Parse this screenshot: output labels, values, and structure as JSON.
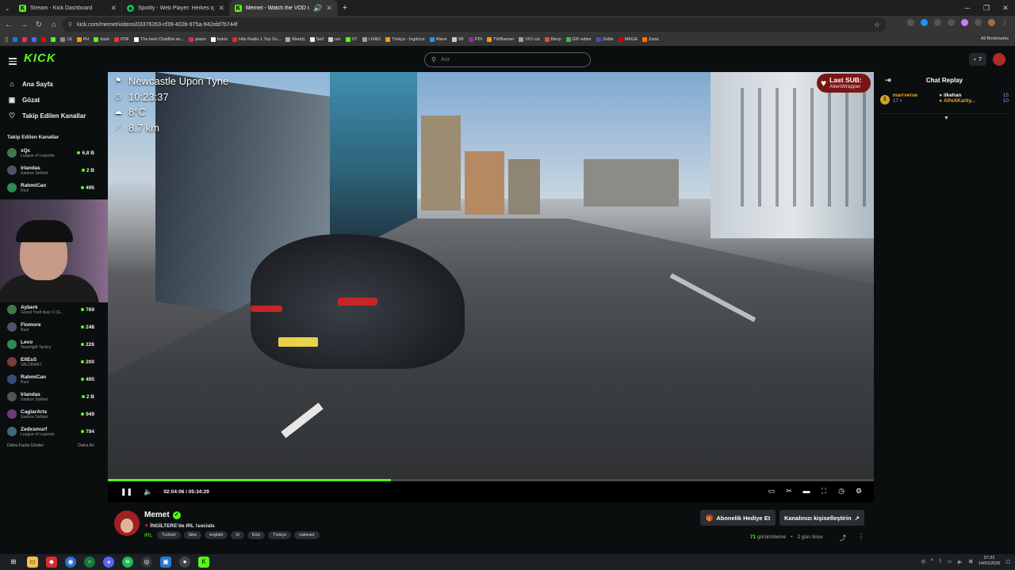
{
  "browser": {
    "tabs": [
      {
        "title": "Stream - Kick Dashboard",
        "color": "#53fc18",
        "glyph": "K"
      },
      {
        "title": "Spotify - Web Player: Herkes için",
        "color": "#1db954",
        "glyph": "●"
      },
      {
        "title": "Memet - Watch the VOD on",
        "color": "#53fc18",
        "glyph": "K"
      }
    ],
    "url": "kick.com/memet/videos/03376263-cf39-402b-975a-942ebf7b744f",
    "bookmarks": [
      "L8",
      "PH",
      "dash",
      "PDF",
      "The best ChatBot an...",
      "piano",
      "botrix",
      "Hits Radio 1 Top So...",
      "Metafy",
      "Sell",
      "rev",
      "XT",
      "LIVAD",
      "Türkçe - İngilizce",
      "Wave",
      "SB",
      "PDI",
      "TWBanner",
      "VIO cut",
      "Blerp",
      "GIF editor",
      "Zettle",
      "MEGA",
      "Zaria"
    ],
    "all_bookmarks": "All Bookmarks"
  },
  "header": {
    "logo": "KICK",
    "search_placeholder": "Ara",
    "viewer_count": "7"
  },
  "sidebar": {
    "nav": [
      {
        "label": "Ana Sayfa",
        "icon": "home-icon",
        "glyph": "⌂"
      },
      {
        "label": "Gözat",
        "icon": "browse-icon",
        "glyph": "▣"
      },
      {
        "label": "Takip Edilen Kanallar",
        "icon": "heart-icon",
        "glyph": "♡"
      }
    ],
    "section_title": "Takip Edilen Kanallar",
    "channels_top": [
      {
        "name": "xQc",
        "category": "League of Legends",
        "viewers": "6,8 B"
      },
      {
        "name": "Irlandas",
        "category": "Sadece Sohbet",
        "viewers": "2 B"
      },
      {
        "name": "RahmiCan",
        "category": "Rust",
        "viewers": "495"
      }
    ],
    "channels_bottom": [
      {
        "name": "Ayberk",
        "category": "Grand Theft Auto V (G...",
        "viewers": "769"
      },
      {
        "name": "Flomore",
        "category": "Rust",
        "viewers": "248"
      },
      {
        "name": "Levo",
        "category": "Teamfight Tactics",
        "viewers": "226"
      },
      {
        "name": "EllEsS",
        "category": "VALORANT",
        "viewers": "200"
      },
      {
        "name": "RahmiCan",
        "category": "Rust",
        "viewers": "495"
      },
      {
        "name": "Irlandas",
        "category": "Sadece Sohbet",
        "viewers": "2 B"
      },
      {
        "name": "CaglarArts",
        "category": "Sadece Sohbet",
        "viewers": "949"
      },
      {
        "name": "Zedxsmurf",
        "category": "League of Legends",
        "viewers": "794"
      }
    ],
    "show_more": "Daha Fazla Göster",
    "show_less": "Daha Az"
  },
  "player": {
    "hud": {
      "location": "Newcastle Upon Tyne",
      "time": "10:23:37",
      "temp": "8°C",
      "distance": "8.7 km"
    },
    "last_sub_title": "Last SUB:",
    "last_sub_user": "AlienWrapper",
    "time_current": "02:04:06",
    "time_total": "05:34:29",
    "progress": 0.37,
    "accent": "#53fc18"
  },
  "chat": {
    "title": "Chat Replay",
    "gifters": [
      {
        "rank": "1",
        "name": "marrverse",
        "count": "17"
      },
      {
        "name": "ilkehan",
        "count": "15"
      },
      {
        "name": "APeXKarliy...",
        "count": "10"
      }
    ]
  },
  "stream": {
    "name": "Memet",
    "title": "İNGİLTERE'de IRL !socials",
    "category": "IRL",
    "tags": [
      "Turkish",
      "bike",
      "english",
      "irl",
      "Kick",
      "Türkçe",
      "valorant"
    ],
    "gift_button": "Abonelik Hediye Et",
    "customize_button": "Kanalınızı kişiselleştirin",
    "views_count": "71",
    "views_label": "görüntüleme",
    "ago": "2 gün önce"
  },
  "taskbar": {
    "time": "07:22",
    "date": "14/01/2026"
  }
}
